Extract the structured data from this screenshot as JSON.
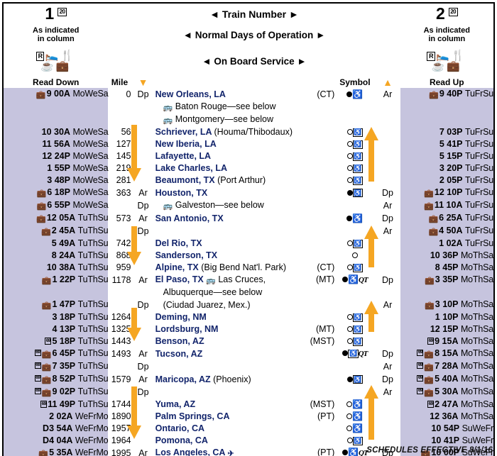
{
  "header": {
    "train_left": "1",
    "train_left_ref": "20",
    "train_right": "2",
    "train_right_ref": "20",
    "train_number_label": "◄ Train Number ►",
    "days_label": "◄ Normal Days of Operation ►",
    "onboard_label": "◄ On Board Service ►",
    "as_indicated_left": "As indicated\nin column",
    "as_indicated_right": "As indicated\nin column",
    "as_indicated_l1": "As indicated",
    "as_indicated_l2": "in column",
    "service_icons_row1": "R-icon sleeper-icon dining-icon",
    "service_icons_row2": "cafe-icon checked-baggage-icon"
  },
  "columns": {
    "read_down": "Read Down",
    "mile": "Mile",
    "down_arrow": "▼",
    "station": "",
    "symbol": "Symbol",
    "up_arrow": "▲",
    "read_up": "Read Up"
  },
  "footer": {
    "effective": "SCHEDULES EFFECTIVE 8/1/16"
  },
  "colors": {
    "time_band": "#c6c4de",
    "station_text": "#12246b",
    "arrow_orange": "#f5a623",
    "border": "#000000"
  },
  "rows": [
    {
      "id": "new-orleans",
      "down_bag": true,
      "down_ref": "",
      "down_hr": "9 00A",
      "down_dow": "MoWeSa",
      "mile": "0",
      "ar_dp": "Dp",
      "station": "New Orleans, LA",
      "station_paren": "",
      "tz": "(CT)",
      "symbol": "filled-wheelchair",
      "dir": "Ar",
      "up_bag": true,
      "up_ref": "",
      "up_hr": "9 40P",
      "up_dow": "TuFrSu"
    },
    {
      "id": "baton-rouge-bus",
      "sub": "Baton Rouge—see below",
      "sub_icon": "bus-icon"
    },
    {
      "id": "montgomery-bus",
      "sub": "Montgomery—see below",
      "sub_icon": "bus-icon"
    },
    {
      "id": "schriever",
      "down_bag": false,
      "down_hr": "10 30A",
      "down_dow": "MoWeSa",
      "mile": "56",
      "ar_dp": "",
      "station": "Schriever, LA",
      "station_paren": "(Houma/Thibodaux)",
      "tz": "",
      "symbol": "open-wheelchair-box",
      "dir": "",
      "up_bag": false,
      "up_hr": "7 03P",
      "up_dow": "TuFrSu"
    },
    {
      "id": "new-iberia",
      "down_bag": false,
      "down_hr": "11 56A",
      "down_dow": "MoWeSa",
      "mile": "127",
      "ar_dp": "",
      "station": "New Iberia, LA",
      "station_paren": "",
      "tz": "",
      "symbol": "open-wheelchair-box",
      "dir": "",
      "up_bag": false,
      "up_hr": "5 41P",
      "up_dow": "TuFrSu"
    },
    {
      "id": "lafayette",
      "down_bag": false,
      "down_hr": "12 24P",
      "down_dow": "MoWeSa",
      "mile": "145",
      "ar_dp": "",
      "station": "Lafayette, LA",
      "station_paren": "",
      "tz": "",
      "symbol": "open-wheelchair-box",
      "dir": "",
      "up_bag": false,
      "up_hr": "5 15P",
      "up_dow": "TuFrSu"
    },
    {
      "id": "lake-charles",
      "down_bag": false,
      "down_hr": "1 55P",
      "down_dow": "MoWeSa",
      "mile": "219",
      "ar_dp": "",
      "station": "Lake Charles, LA",
      "station_paren": "",
      "tz": "",
      "symbol": "open-wheelchair-box",
      "dir": "",
      "up_bag": false,
      "up_hr": "3 20P",
      "up_dow": "TuFrSu"
    },
    {
      "id": "beaumont",
      "down_bag": false,
      "down_hr": "3 48P",
      "down_dow": "MoWeSa",
      "mile": "281",
      "ar_dp": "",
      "station": "Beaumont, TX",
      "station_paren": "(Port Arthur)",
      "tz": "",
      "symbol": "open-wheelchair-box",
      "dir": "",
      "up_bag": false,
      "up_hr": "2 05P",
      "up_dow": "TuFrSu"
    },
    {
      "id": "houston-ar",
      "down_bag": true,
      "down_hr": "6 18P",
      "down_dow": "MoWeSa",
      "mile": "363",
      "ar_dp": "Ar",
      "station": "Houston, TX",
      "station_paren": "",
      "tz": "",
      "symbol": "filled-wheelchair-box",
      "dir": "Dp",
      "up_bag": true,
      "up_hr": "12 10P",
      "up_dow": "TuFrSu"
    },
    {
      "id": "houston-dp",
      "down_bag": true,
      "down_hr": "6 55P",
      "down_dow": "MoWeSa",
      "mile": "",
      "ar_dp": "Dp",
      "sub": "Galveston—see below",
      "sub_icon": "bus-icon",
      "symbol": "",
      "dir": "Ar",
      "up_bag": true,
      "up_hr": "11 10A",
      "up_dow": "TuFrSu"
    },
    {
      "id": "san-antonio-ar",
      "down_bag": true,
      "down_hr": "12 05A",
      "down_dow": "TuThSu",
      "mile": "573",
      "ar_dp": "Ar",
      "station": "San Antonio, TX",
      "station_paren": "",
      "tz": "",
      "symbol": "filled-wheelchair",
      "dir": "Dp",
      "up_bag": true,
      "up_hr": "6 25A",
      "up_dow": "TuFrSu"
    },
    {
      "id": "san-antonio-dp",
      "down_bag": true,
      "down_hr": "2 45A",
      "down_dow": "TuThSu",
      "mile": "",
      "ar_dp": "Dp",
      "station": "",
      "station_paren": "",
      "tz": "",
      "symbol": "",
      "dir": "Ar",
      "up_bag": true,
      "up_hr": "4 50A",
      "up_dow": "TuFrSu"
    },
    {
      "id": "del-rio",
      "down_bag": false,
      "down_hr": "5 49A",
      "down_dow": "TuThSu",
      "mile": "742",
      "ar_dp": "",
      "station": "Del Rio, TX",
      "station_paren": "",
      "tz": "",
      "symbol": "open-wheelchair-box",
      "dir": "",
      "up_bag": false,
      "up_hr": "1 02A",
      "up_dow": "TuFrSu"
    },
    {
      "id": "sanderson",
      "down_bag": false,
      "down_hr": "8 24A",
      "down_dow": "TuThSu",
      "mile": "868",
      "ar_dp": "",
      "station": "Sanderson, TX",
      "station_paren": "",
      "tz": "",
      "symbol": "open-only",
      "dir": "",
      "up_bag": false,
      "up_hr": "10 36P",
      "up_dow": "MoThSa"
    },
    {
      "id": "alpine",
      "down_bag": false,
      "down_hr": "10 38A",
      "down_dow": "TuThSu",
      "mile": "959",
      "ar_dp": "",
      "station": "Alpine, TX",
      "station_paren": "(Big Bend Nat'l. Park)",
      "tz": "(CT)",
      "symbol": "open-wheelchair-box",
      "dir": "",
      "up_bag": false,
      "up_hr": "8 45P",
      "up_dow": "MoThSa"
    },
    {
      "id": "el-paso-ar",
      "down_bag": true,
      "down_hr": "1 22P",
      "down_dow": "TuThSu",
      "mile": "1178",
      "ar_dp": "Ar",
      "station": "El Paso, TX",
      "station_bus": "Las Cruces,",
      "tz": "(MT)",
      "symbol": "filled-wheelchair-qt",
      "dir": "Dp",
      "up_bag": true,
      "up_hr": "3 35P",
      "up_dow": "MoThSa"
    },
    {
      "id": "el-paso-sub1",
      "sub_plain": "Albuquerque—see below"
    },
    {
      "id": "el-paso-dp",
      "down_bag": true,
      "down_hr": "1 47P",
      "down_dow": "TuThSu",
      "mile": "",
      "ar_dp": "Dp",
      "sub_plain": "(Ciudad Juarez, Mex.)",
      "symbol": "",
      "dir": "Ar",
      "up_bag": true,
      "up_hr": "3 10P",
      "up_dow": "MoThSa"
    },
    {
      "id": "deming",
      "down_bag": false,
      "down_hr": "3 18P",
      "down_dow": "TuThSu",
      "mile": "1264",
      "ar_dp": "",
      "station": "Deming, NM",
      "station_paren": "",
      "tz": "",
      "symbol": "open-wheelchair-box",
      "dir": "",
      "up_bag": false,
      "up_hr": "1 10P",
      "up_dow": "MoThSa"
    },
    {
      "id": "lordsburg",
      "down_bag": false,
      "down_hr": "4 13P",
      "down_dow": "TuThSu",
      "mile": "1325",
      "ar_dp": "",
      "station": "Lordsburg, NM",
      "station_paren": "",
      "tz": "(MT)",
      "symbol": "open-wheelchair-box",
      "dir": "",
      "up_bag": false,
      "up_hr": "12 15P",
      "up_dow": "MoThSa"
    },
    {
      "id": "benson",
      "down_bag": false,
      "down_ref": "69",
      "down_hr": "5 18P",
      "down_dow": "TuThSu",
      "mile": "1443",
      "ar_dp": "",
      "station": "Benson, AZ",
      "station_paren": "",
      "tz": "(MST)",
      "symbol": "open-wheelchair-box",
      "dir": "",
      "up_bag": false,
      "up_ref": "69",
      "up_hr": "9 15A",
      "up_dow": "MoThSa"
    },
    {
      "id": "tucson-ar",
      "down_bag": true,
      "down_ref": "69",
      "down_hr": "6 45P",
      "down_dow": "TuThSu",
      "mile": "1493",
      "ar_dp": "Ar",
      "station": "Tucson, AZ",
      "station_paren": "",
      "tz": "",
      "symbol": "filled-wheelchair-box-qt",
      "dir": "Dp",
      "up_bag": true,
      "up_ref": "69",
      "up_hr": "8 15A",
      "up_dow": "MoThSa"
    },
    {
      "id": "tucson-dp",
      "down_bag": true,
      "down_ref": "69",
      "down_hr": "7 35P",
      "down_dow": "TuThSu",
      "mile": "",
      "ar_dp": "Dp",
      "station": "",
      "station_paren": "",
      "tz": "",
      "symbol": "",
      "dir": "Ar",
      "up_bag": true,
      "up_ref": "69",
      "up_hr": "7 28A",
      "up_dow": "MoThSa"
    },
    {
      "id": "maricopa-ar",
      "down_bag": true,
      "down_ref": "69",
      "down_hr": "8 52P",
      "down_dow": "TuThSu",
      "mile": "1579",
      "ar_dp": "Ar",
      "station": "Maricopa, AZ",
      "station_paren": "(Phoenix)",
      "tz": "",
      "symbol": "filled-wheelchair-box",
      "dir": "Dp",
      "up_bag": true,
      "up_ref": "69",
      "up_hr": "5 40A",
      "up_dow": "MoThSa"
    },
    {
      "id": "maricopa-dp",
      "down_bag": true,
      "down_ref": "69",
      "down_hr": "9 02P",
      "down_dow": "TuThSu",
      "mile": "",
      "ar_dp": "Dp",
      "station": "",
      "station_paren": "",
      "tz": "",
      "symbol": "",
      "dir": "Ar",
      "up_bag": true,
      "up_ref": "69",
      "up_hr": "5 30A",
      "up_dow": "MoThSa"
    },
    {
      "id": "yuma",
      "down_bag": false,
      "down_ref": "69",
      "down_hr": "11 49P",
      "down_dow": "TuThSu",
      "mile": "1744",
      "ar_dp": "",
      "station": "Yuma, AZ",
      "station_paren": "",
      "tz": "(MST)",
      "symbol": "open-wheelchair",
      "dir": "",
      "up_bag": false,
      "up_ref": "69",
      "up_hr": "2 47A",
      "up_dow": "MoThSa"
    },
    {
      "id": "palm-springs",
      "down_bag": false,
      "down_hr": "2 02A",
      "down_dow": "WeFrMo",
      "mile": "1890",
      "ar_dp": "",
      "station": "Palm Springs, CA",
      "station_paren": "",
      "tz": "(PT)",
      "symbol": "open-wheelchair",
      "dir": "",
      "up_bag": false,
      "up_hr": "12 36A",
      "up_dow": "MoThSa"
    },
    {
      "id": "ontario",
      "down_bag": false,
      "down_prefix": "D",
      "down_hr": "3 54A",
      "down_dow": "WeFrMo",
      "mile": "1957",
      "ar_dp": "",
      "station": "Ontario, CA",
      "station_paren": "",
      "tz": "",
      "symbol": "open-wheelchair",
      "dir": "",
      "up_bag": false,
      "up_hr": "10 54P",
      "up_dow": "SuWeFr"
    },
    {
      "id": "pomona",
      "down_bag": false,
      "down_prefix": "D",
      "down_hr": "4 04A",
      "down_dow": "WeFrMo",
      "mile": "1964",
      "ar_dp": "",
      "station": "Pomona, CA",
      "station_paren": "",
      "tz": "",
      "symbol": "open-wheelchair-box",
      "dir": "",
      "up_bag": false,
      "up_hr": "10 41P",
      "up_dow": "SuWeFr"
    },
    {
      "id": "los-angeles",
      "down_bag": true,
      "down_hr": "5 35A",
      "down_dow": "WeFrMo",
      "mile": "1995",
      "ar_dp": "Ar",
      "station": "Los Angeles, CA",
      "station_plane": true,
      "station_paren": "",
      "tz": "(PT)",
      "symbol": "filled-wheelchair-qt",
      "dir": "Dp",
      "up_bag": true,
      "up_hr": "10 00P",
      "up_dow": "SuWeFr"
    }
  ]
}
